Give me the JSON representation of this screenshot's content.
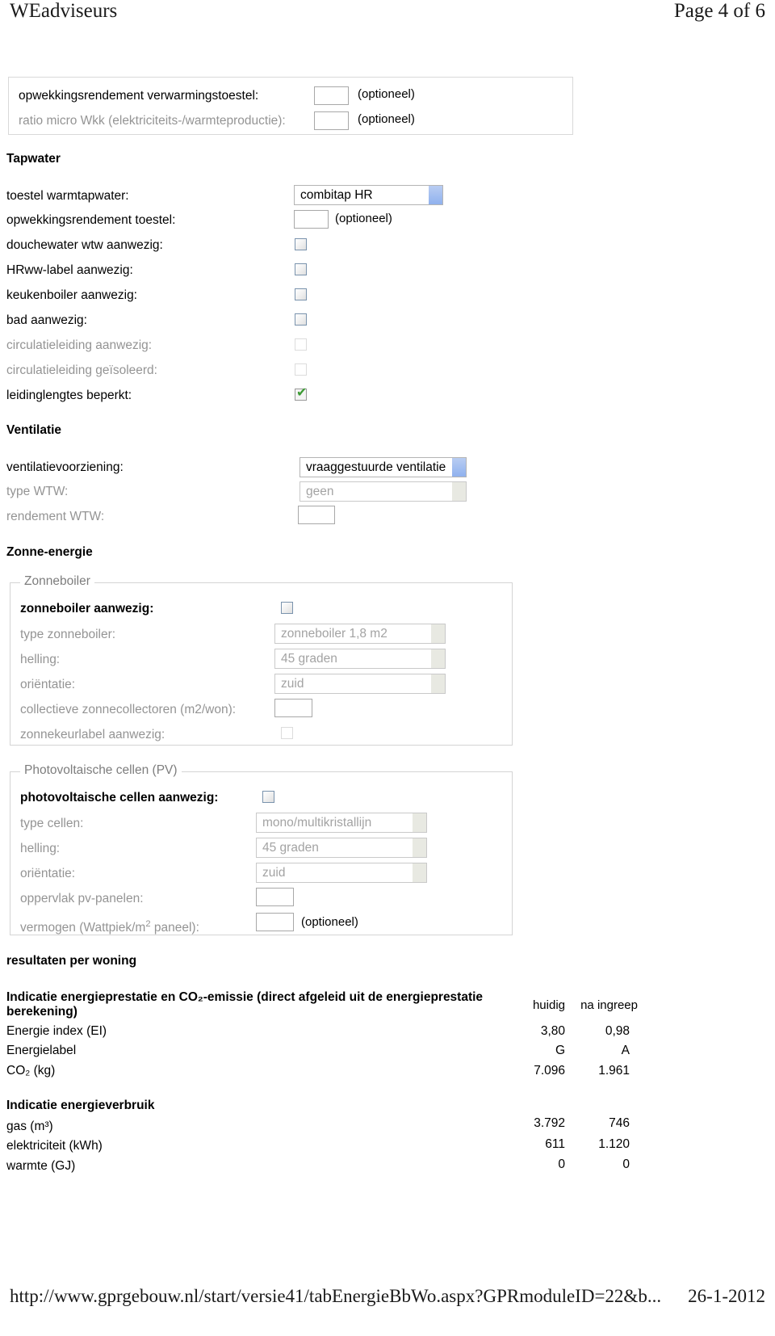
{
  "print": {
    "header_left": "WEadviseurs",
    "header_right": "Page 4 of 6",
    "footer_left": "http://www.gprgebouw.nl/start/versie41/tabEnergieBbWo.aspx?GPRmoduleID=22&b...",
    "footer_right": "26-1-2012"
  },
  "top_panel": {
    "rows": [
      {
        "label": "opwekkingsrendement verwarmingstoestel:",
        "value": "",
        "optional": "(optioneel)"
      },
      {
        "label": "ratio micro Wkk (elektriciteits-/warmteproductie):",
        "value": "",
        "optional": "(optioneel)"
      }
    ]
  },
  "tapwater": {
    "title": "Tapwater",
    "toestel_label": "toestel warmtapwater:",
    "toestel_value": "combitap HR",
    "rendement_label": "opwekkingsrendement toestel:",
    "rendement_value": "",
    "rendement_optional": "(optioneel)",
    "checks": [
      {
        "label": "douchewater wtw aanwezig:",
        "checked": false,
        "disabled": false
      },
      {
        "label": "HRww-label aanwezig:",
        "checked": false,
        "disabled": false
      },
      {
        "label": "keukenboiler aanwezig:",
        "checked": false,
        "disabled": false
      },
      {
        "label": "bad aanwezig:",
        "checked": false,
        "disabled": false
      },
      {
        "label": "circulatieleiding aanwezig:",
        "checked": false,
        "disabled": true
      },
      {
        "label": "circulatieleiding geïsoleerd:",
        "checked": false,
        "disabled": true
      },
      {
        "label": "leidinglengtes beperkt:",
        "checked": true,
        "disabled": false
      }
    ]
  },
  "ventilatie": {
    "title": "Ventilatie",
    "voorziening_label": "ventilatievoorziening:",
    "voorziening_value": "vraaggestuurde ventilatie",
    "wtw_label": "type WTW:",
    "wtw_value": "geen",
    "rendement_label": "rendement WTW:",
    "rendement_value": ""
  },
  "zonne_energie": {
    "title": "Zonne-energie",
    "zonneboiler": {
      "legend": "Zonneboiler",
      "aanwezig_label": "zonneboiler aanwezig:",
      "type_label": "type zonneboiler:",
      "type_value": "zonneboiler 1,8 m2",
      "helling_label": "helling:",
      "helling_value": "45 graden",
      "orientatie_label": "oriëntatie:",
      "orientatie_value": "zuid",
      "collectief_label": "collectieve zonnecollectoren (m2/won):",
      "collectief_value": "",
      "keurlabel_label": "zonnekeurlabel aanwezig:"
    },
    "pv": {
      "legend": "Photovoltaische cellen (PV)",
      "aanwezig_label": "photovoltaische cellen aanwezig:",
      "type_label": "type cellen:",
      "type_value": "mono/multikristallijn",
      "helling_label": "helling:",
      "helling_value": "45 graden",
      "orientatie_label": "oriëntatie:",
      "orientatie_value": "zuid",
      "oppervlak_label": "oppervlak pv-panelen:",
      "oppervlak_value": "",
      "vermogen_label_pre": "vermogen (Wattpiek/m",
      "vermogen_label_sup": "2",
      "vermogen_label_post": " paneel):",
      "vermogen_value": "",
      "vermogen_optional": "(optioneel)"
    }
  },
  "results": {
    "title": "resultaten per woning",
    "col_headers": [
      "huidig",
      "na ingreep"
    ],
    "group1": {
      "heading": "Indicatie energieprestatie en CO₂-emissie (direct afgeleid uit de energieprestatie berekening)",
      "rows": [
        {
          "label": "Energie index (EI)",
          "huidig": "3,80",
          "na_ingreep": "0,98"
        },
        {
          "label": "Energielabel",
          "huidig": "G",
          "na_ingreep": "A"
        },
        {
          "label": "CO₂ (kg)",
          "huidig": "7.096",
          "na_ingreep": "1.961"
        }
      ]
    },
    "group2": {
      "heading": "Indicatie energieverbruik",
      "rows": [
        {
          "label": "gas (m³)",
          "huidig": "3.792",
          "na_ingreep": "746"
        },
        {
          "label": "elektriciteit (kWh)",
          "huidig": "611",
          "na_ingreep": "1.120"
        },
        {
          "label": "warmte (GJ)",
          "huidig": "0",
          "na_ingreep": "0"
        }
      ]
    }
  }
}
